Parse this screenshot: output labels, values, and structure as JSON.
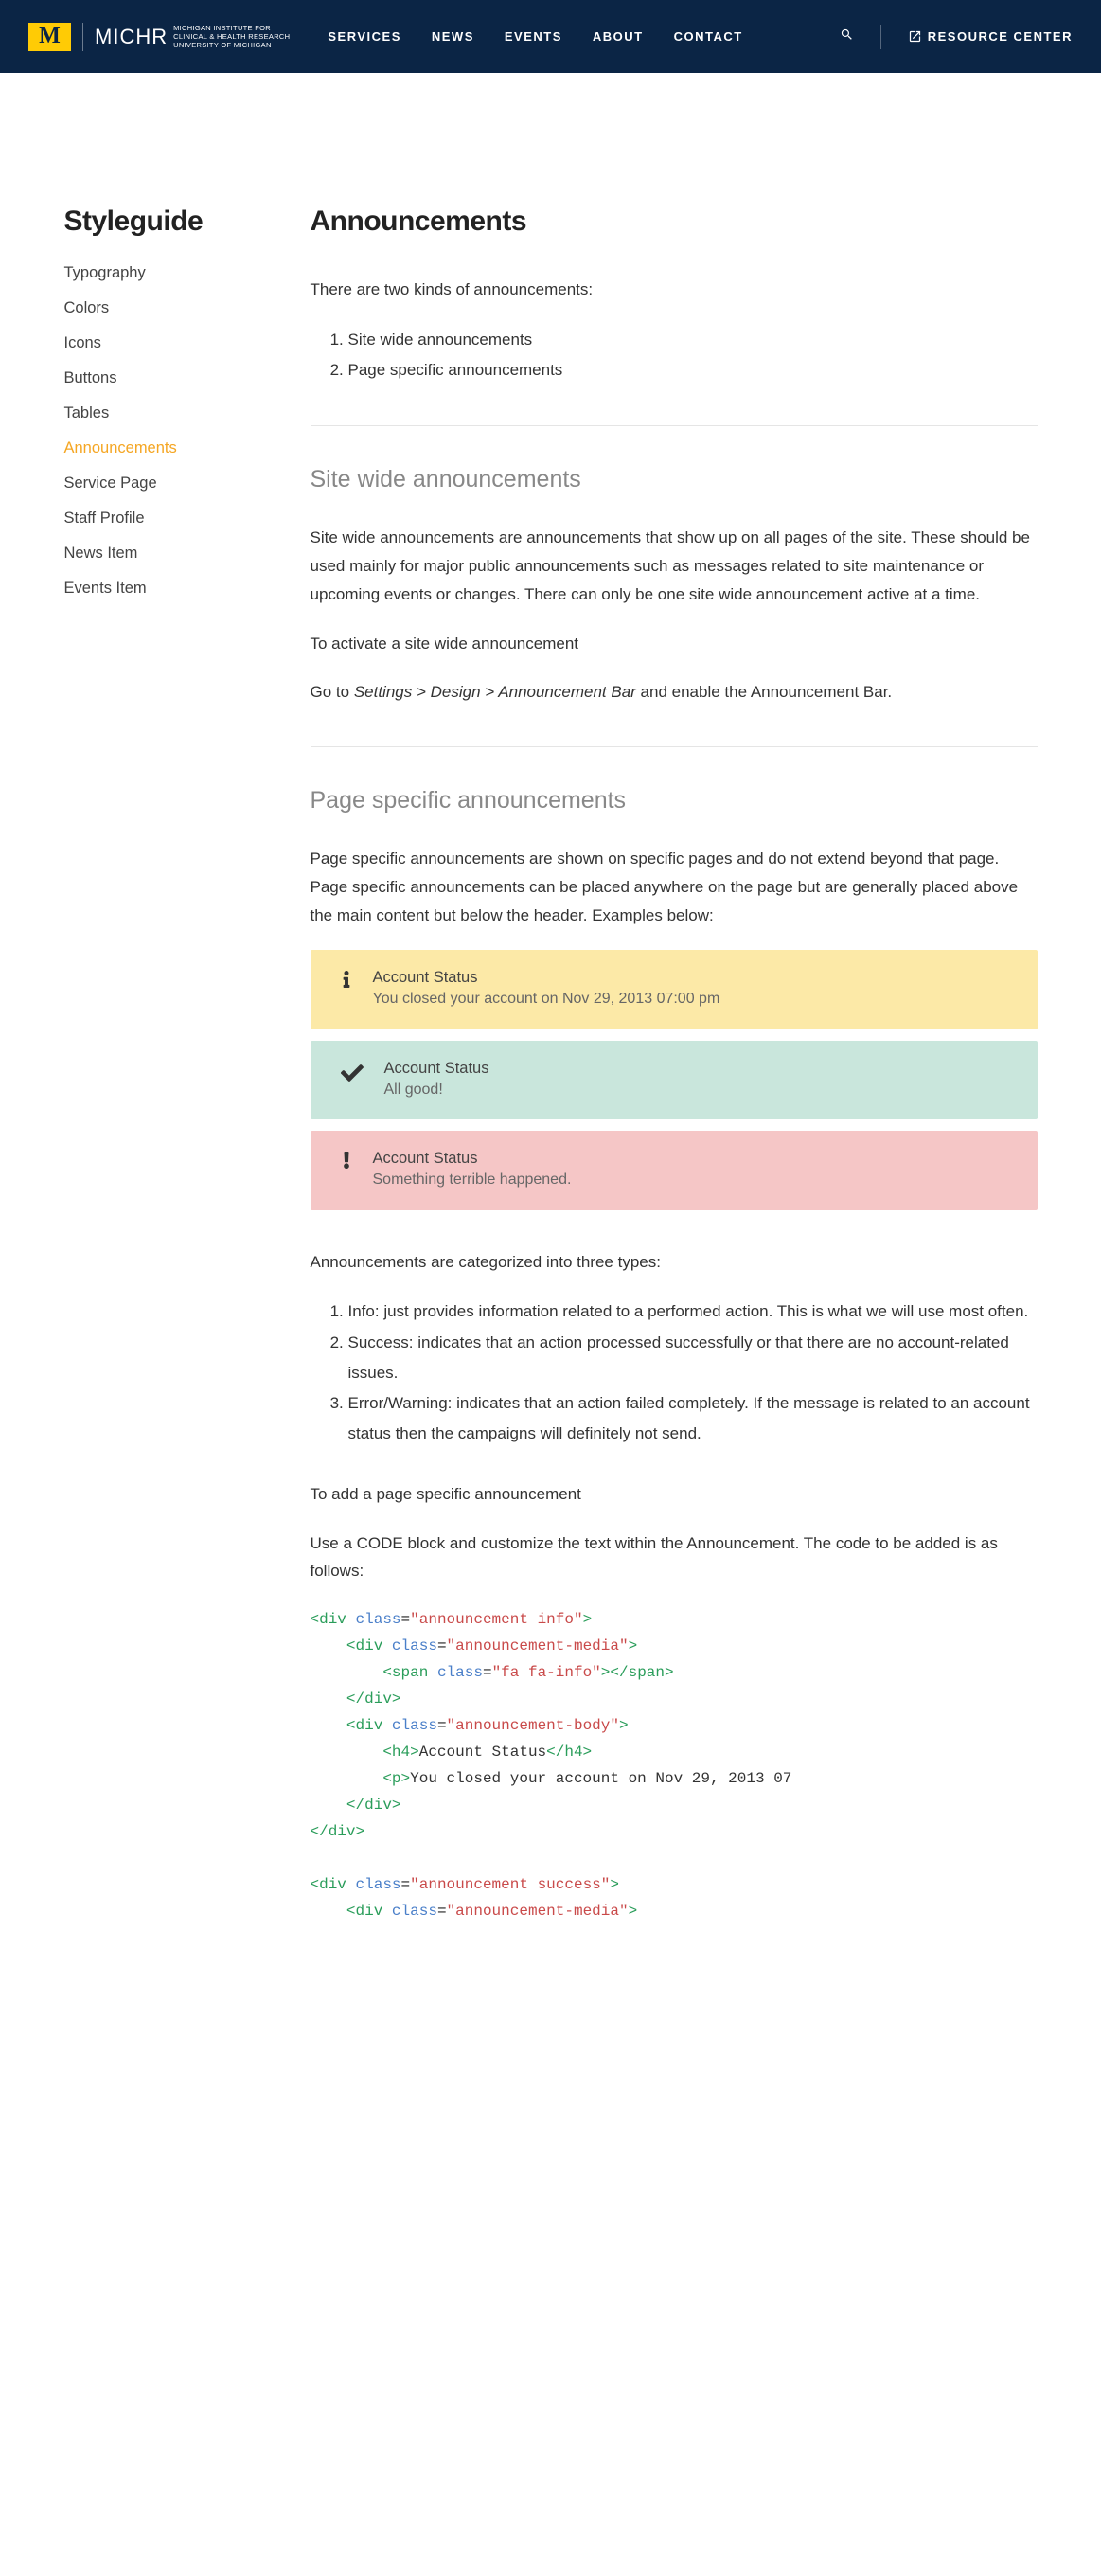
{
  "nav": {
    "org_top": "MICHIGAN INSTITUTE FOR",
    "org_mid": "CLINICAL & HEALTH RESEARCH",
    "org_bot": "UNIVERSITY OF MICHIGAN",
    "michr": "MICHR",
    "links": [
      "SERVICES",
      "NEWS",
      "EVENTS",
      "ABOUT",
      "CONTACT"
    ],
    "resource": "RESOURCE CENTER"
  },
  "sidebar": {
    "title": "Styleguide",
    "items": [
      "Typography",
      "Colors",
      "Icons",
      "Buttons",
      "Tables",
      "Announcements",
      "Service Page",
      "Staff Profile",
      "News Item",
      "Events Item"
    ],
    "active": "Announcements"
  },
  "content": {
    "h1": "Announcements",
    "intro": "There are two kinds of announcements:",
    "kinds": [
      "Site wide announcements",
      "Page specific announcements"
    ],
    "sitewide_h": "Site wide announcements",
    "sitewide_p": "Site wide announcements are announcements that show up on all pages of the site. These should be used mainly for major public announcements such as messages related to site maintenance or upcoming events or changes. There can only be one site wide announcement active at a time.",
    "activate_h": "To activate a site wide announcement",
    "activate_pre": "Go to ",
    "activate_em": "Settings > Design > Announcement Bar",
    "activate_post": " and enable the Announcement Bar.",
    "page_h": "Page specific announcements",
    "page_p": "Page specific announcements are shown on specific pages and do not extend beyond that page. Page specific announcements can be placed anywhere on the page but are generally placed above the main content but below the header. Examples below:",
    "examples": {
      "info": {
        "title": "Account Status",
        "body": "You closed your account on Nov 29, 2013 07:00 pm"
      },
      "success": {
        "title": "Account Status",
        "body": "All good!"
      },
      "error": {
        "title": "Account Status",
        "body": "Something terrible happened."
      }
    },
    "cats_intro": "Announcements are categorized into three types:",
    "cats": [
      {
        "label": "Info:",
        "text": " just provides information related to a performed action. This is what we will use most often."
      },
      {
        "label": "Success:",
        "text": " indicates that an action processed successfully or that there are no account-related issues."
      },
      {
        "label": "Error/Warning:",
        "text": " indicates that an action failed completely. If the message is related to an account status then the campaigns will definitely not send."
      }
    ],
    "add_h": "To add a page specific announcement",
    "add_p": "Use a CODE block and customize the text within the Announcement. The code to be added is as follows:"
  }
}
